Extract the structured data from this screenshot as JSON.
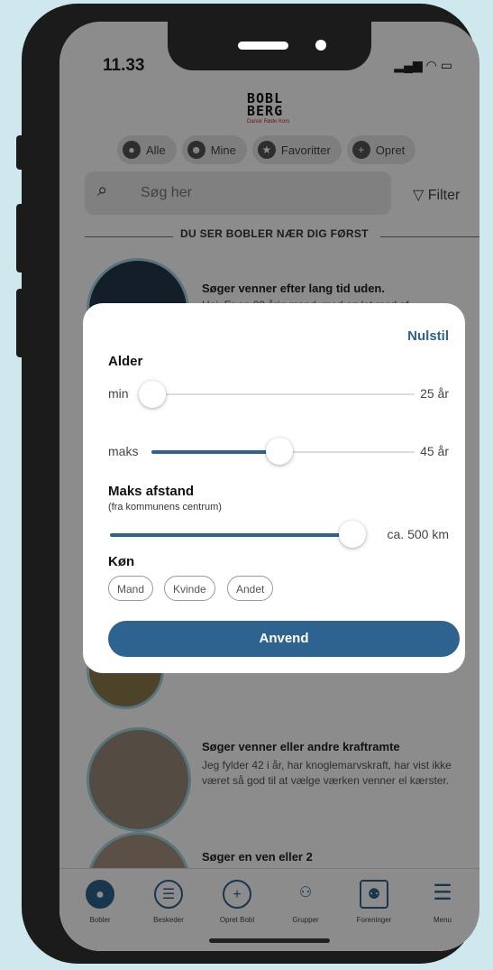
{
  "status_bar": {
    "time": "11.33",
    "icons": "signal-wifi-battery"
  },
  "logo": {
    "line1": "BOBL",
    "line2": "BERG",
    "tag": "Dansk Røde Kors"
  },
  "chips": [
    {
      "label": "Alle",
      "icon": "circle-icon"
    },
    {
      "label": "Mine",
      "icon": "person-icon"
    },
    {
      "label": "Favoritter",
      "icon": "star-icon"
    },
    {
      "label": "Opret",
      "icon": "plus-icon"
    }
  ],
  "search": {
    "placeholder": "Søg her",
    "filter_label": "Filter"
  },
  "divider_text": "DU SER BOBLER NÆR DIG FØRST",
  "posts": [
    {
      "title": "Søger venner efter lang tid uden.",
      "body": "Hej. Er en 29 årig mand, med en lot med af"
    },
    {
      "title": "Søger venner eller andre kraftramte",
      "body": "Jeg fylder 42 i år, har knoglemarvskraft, har vist ikke været så god til at vælge værken venner el kærster."
    },
    {
      "title": "Søger en ven eller 2",
      "body": ""
    }
  ],
  "filter_modal": {
    "reset_label": "Nulstil",
    "age_label": "Alder",
    "min_label": "min",
    "min_value": "25 år",
    "min_fraction": 0.0,
    "max_label": "maks",
    "max_value": "45 år",
    "max_fraction": 0.47,
    "distance_label": "Maks afstand",
    "distance_sub": "(fra kommunens centrum)",
    "distance_value": "ca. 500 km",
    "distance_fraction": 1.0,
    "gender_label": "Køn",
    "genders": [
      "Mand",
      "Kvinde",
      "Andet"
    ],
    "apply_label": "Anvend"
  },
  "tabbar": [
    {
      "label": "Bobler",
      "icon": "bubble-icon",
      "active": true
    },
    {
      "label": "Beskeder",
      "icon": "chat-icon",
      "active": false
    },
    {
      "label": "Opret Bobl",
      "icon": "plus-icon",
      "active": false
    },
    {
      "label": "Grupper",
      "icon": "group-icon",
      "active": false
    },
    {
      "label": "Foreninger",
      "icon": "org-icon",
      "active": false
    },
    {
      "label": "Menu",
      "icon": "menu-icon",
      "active": false
    }
  ],
  "colors": {
    "accent": "#2e6390",
    "bubble_border": "#9fd6e0",
    "logo_red": "#c62828"
  }
}
